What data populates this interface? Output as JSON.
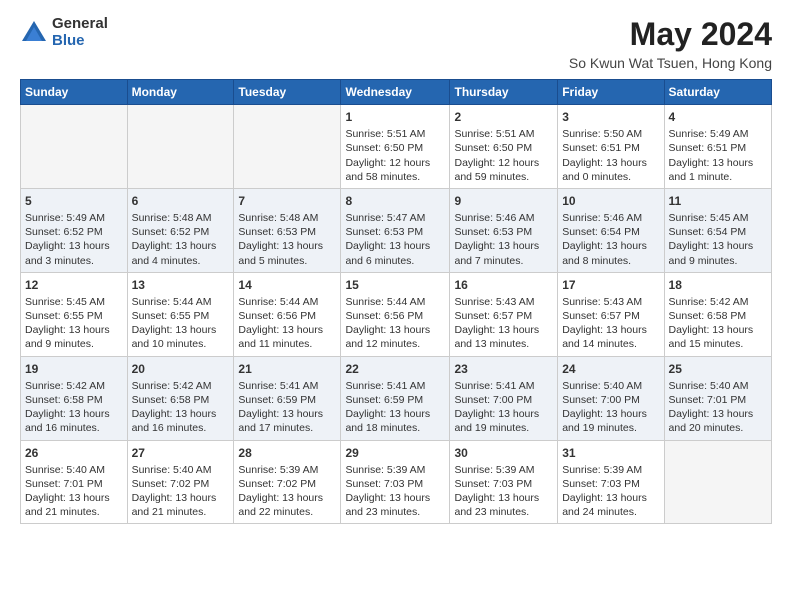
{
  "logo": {
    "general": "General",
    "blue": "Blue"
  },
  "title": "May 2024",
  "subtitle": "So Kwun Wat Tsuen, Hong Kong",
  "days": [
    "Sunday",
    "Monday",
    "Tuesday",
    "Wednesday",
    "Thursday",
    "Friday",
    "Saturday"
  ],
  "weeks": [
    [
      {
        "date": "",
        "info": ""
      },
      {
        "date": "",
        "info": ""
      },
      {
        "date": "",
        "info": ""
      },
      {
        "date": "1",
        "info": "Sunrise: 5:51 AM\nSunset: 6:50 PM\nDaylight: 12 hours\nand 58 minutes."
      },
      {
        "date": "2",
        "info": "Sunrise: 5:51 AM\nSunset: 6:50 PM\nDaylight: 12 hours\nand 59 minutes."
      },
      {
        "date": "3",
        "info": "Sunrise: 5:50 AM\nSunset: 6:51 PM\nDaylight: 13 hours\nand 0 minutes."
      },
      {
        "date": "4",
        "info": "Sunrise: 5:49 AM\nSunset: 6:51 PM\nDaylight: 13 hours\nand 1 minute."
      }
    ],
    [
      {
        "date": "5",
        "info": "Sunrise: 5:49 AM\nSunset: 6:52 PM\nDaylight: 13 hours\nand 3 minutes."
      },
      {
        "date": "6",
        "info": "Sunrise: 5:48 AM\nSunset: 6:52 PM\nDaylight: 13 hours\nand 4 minutes."
      },
      {
        "date": "7",
        "info": "Sunrise: 5:48 AM\nSunset: 6:53 PM\nDaylight: 13 hours\nand 5 minutes."
      },
      {
        "date": "8",
        "info": "Sunrise: 5:47 AM\nSunset: 6:53 PM\nDaylight: 13 hours\nand 6 minutes."
      },
      {
        "date": "9",
        "info": "Sunrise: 5:46 AM\nSunset: 6:53 PM\nDaylight: 13 hours\nand 7 minutes."
      },
      {
        "date": "10",
        "info": "Sunrise: 5:46 AM\nSunset: 6:54 PM\nDaylight: 13 hours\nand 8 minutes."
      },
      {
        "date": "11",
        "info": "Sunrise: 5:45 AM\nSunset: 6:54 PM\nDaylight: 13 hours\nand 9 minutes."
      }
    ],
    [
      {
        "date": "12",
        "info": "Sunrise: 5:45 AM\nSunset: 6:55 PM\nDaylight: 13 hours\nand 9 minutes."
      },
      {
        "date": "13",
        "info": "Sunrise: 5:44 AM\nSunset: 6:55 PM\nDaylight: 13 hours\nand 10 minutes."
      },
      {
        "date": "14",
        "info": "Sunrise: 5:44 AM\nSunset: 6:56 PM\nDaylight: 13 hours\nand 11 minutes."
      },
      {
        "date": "15",
        "info": "Sunrise: 5:44 AM\nSunset: 6:56 PM\nDaylight: 13 hours\nand 12 minutes."
      },
      {
        "date": "16",
        "info": "Sunrise: 5:43 AM\nSunset: 6:57 PM\nDaylight: 13 hours\nand 13 minutes."
      },
      {
        "date": "17",
        "info": "Sunrise: 5:43 AM\nSunset: 6:57 PM\nDaylight: 13 hours\nand 14 minutes."
      },
      {
        "date": "18",
        "info": "Sunrise: 5:42 AM\nSunset: 6:58 PM\nDaylight: 13 hours\nand 15 minutes."
      }
    ],
    [
      {
        "date": "19",
        "info": "Sunrise: 5:42 AM\nSunset: 6:58 PM\nDaylight: 13 hours\nand 16 minutes."
      },
      {
        "date": "20",
        "info": "Sunrise: 5:42 AM\nSunset: 6:58 PM\nDaylight: 13 hours\nand 16 minutes."
      },
      {
        "date": "21",
        "info": "Sunrise: 5:41 AM\nSunset: 6:59 PM\nDaylight: 13 hours\nand 17 minutes."
      },
      {
        "date": "22",
        "info": "Sunrise: 5:41 AM\nSunset: 6:59 PM\nDaylight: 13 hours\nand 18 minutes."
      },
      {
        "date": "23",
        "info": "Sunrise: 5:41 AM\nSunset: 7:00 PM\nDaylight: 13 hours\nand 19 minutes."
      },
      {
        "date": "24",
        "info": "Sunrise: 5:40 AM\nSunset: 7:00 PM\nDaylight: 13 hours\nand 19 minutes."
      },
      {
        "date": "25",
        "info": "Sunrise: 5:40 AM\nSunset: 7:01 PM\nDaylight: 13 hours\nand 20 minutes."
      }
    ],
    [
      {
        "date": "26",
        "info": "Sunrise: 5:40 AM\nSunset: 7:01 PM\nDaylight: 13 hours\nand 21 minutes."
      },
      {
        "date": "27",
        "info": "Sunrise: 5:40 AM\nSunset: 7:02 PM\nDaylight: 13 hours\nand 21 minutes."
      },
      {
        "date": "28",
        "info": "Sunrise: 5:39 AM\nSunset: 7:02 PM\nDaylight: 13 hours\nand 22 minutes."
      },
      {
        "date": "29",
        "info": "Sunrise: 5:39 AM\nSunset: 7:03 PM\nDaylight: 13 hours\nand 23 minutes."
      },
      {
        "date": "30",
        "info": "Sunrise: 5:39 AM\nSunset: 7:03 PM\nDaylight: 13 hours\nand 23 minutes."
      },
      {
        "date": "31",
        "info": "Sunrise: 5:39 AM\nSunset: 7:03 PM\nDaylight: 13 hours\nand 24 minutes."
      },
      {
        "date": "",
        "info": ""
      }
    ]
  ]
}
